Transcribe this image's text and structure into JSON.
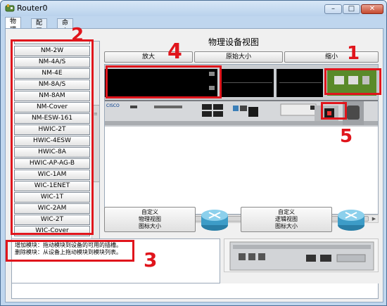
{
  "window": {
    "title": "Router0",
    "minimize_glyph": "–",
    "maximize_glyph": "□",
    "close_glyph": "✕"
  },
  "tabs": [
    {
      "label": "物理",
      "active": true
    },
    {
      "label": "配置",
      "active": false
    },
    {
      "label": "命令行",
      "active": false
    }
  ],
  "module_list": {
    "items": [
      "NM-2W",
      "NM-4A/S",
      "NM-4E",
      "NM-8A/S",
      "NM-8AM",
      "NM-Cover",
      "NM-ESW-161",
      "HWIC-2T",
      "HWIC-4ESW",
      "HWIC-8A",
      "HWIC-AP-AG-B",
      "WIC-1AM",
      "WIC-1ENET",
      "WIC-1T",
      "WIC-2AM",
      "WIC-2T",
      "WIC-Cover"
    ]
  },
  "physical_view": {
    "title": "物理设备视图",
    "zoom_in": "放大",
    "original_size": "原始大小",
    "zoom_out": "缩小"
  },
  "hint": {
    "line1": "增加模块：拖动模块到设备的可用的插槽。",
    "line2": "删除模块：从设备上拖动模块到模块列表。"
  },
  "custom_buttons": {
    "physical": [
      "自定义",
      "物理视图",
      "图标大小"
    ],
    "logical": [
      "自定义",
      "逻辑视图",
      "图标大小"
    ]
  },
  "callouts": [
    "1",
    "2",
    "3",
    "4",
    "5"
  ],
  "colors": {
    "highlight": "#e0151c",
    "window_frame": "#bfd6ee",
    "chassis": "#c9ccd0",
    "slot": "#000000"
  }
}
